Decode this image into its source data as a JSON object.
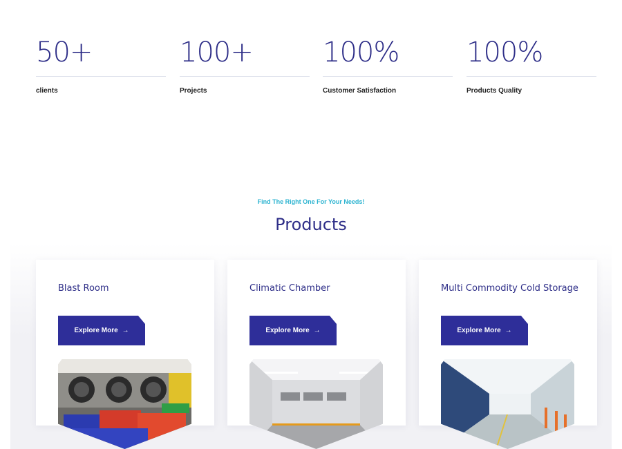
{
  "stats": [
    {
      "value": "50+",
      "label": "clients"
    },
    {
      "value": "100+",
      "label": "Projects"
    },
    {
      "value": "100%",
      "label": "Customer Satisfaction"
    },
    {
      "value": "100%",
      "label": "Products Quality"
    }
  ],
  "products_section": {
    "tagline": "Find The Right One For Your Needs!",
    "title": "Products"
  },
  "products": [
    {
      "title": "Blast Room",
      "button_label": "Explore More",
      "button_icon": "arrow-right-icon"
    },
    {
      "title": "Climatic Chamber",
      "button_label": "Explore More",
      "button_icon": "arrow-right-icon"
    },
    {
      "title": "Multi Commodity Cold Storage",
      "button_label": "Explore More",
      "button_icon": "arrow-right-icon"
    }
  ],
  "colors": {
    "primary": "#2e2e99",
    "heading": "#2e2e88",
    "accent": "#2bb3d0"
  }
}
